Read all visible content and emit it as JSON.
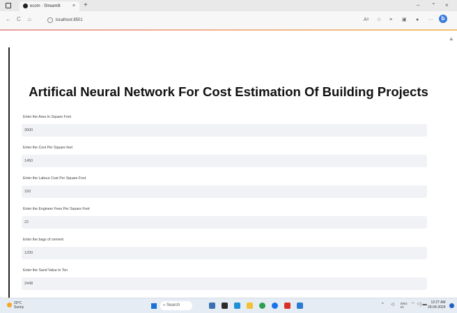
{
  "browser": {
    "tab_title": "ecom · Streamlit",
    "tab_close": "×",
    "new_tab": "+",
    "url": "localhost:8501",
    "minimize": "–",
    "restore": "⌃",
    "close": "×",
    "bing": "b"
  },
  "page": {
    "title": "Artifical Neural Network For Cost Estimation Of Building Projects",
    "fields": [
      {
        "label": "Enter the Area In Square Foot",
        "value": "3000"
      },
      {
        "label": "Enter the Cost Per Square feet",
        "value": "1450"
      },
      {
        "label": "Enter the Labour Cost Per Square Foot",
        "value": "150"
      },
      {
        "label": "Enter the Engineer Fees Per Square Foot",
        "value": "22"
      },
      {
        "label": "Enter the bags of cement",
        "value": "1200"
      },
      {
        "label": "Enter the Sand Value in Ton",
        "value": "2448"
      }
    ]
  },
  "taskbar": {
    "weather_temp": "29°C",
    "weather_desc": "Sunny",
    "search_label": "Search",
    "lang": "ENG",
    "region": "IN",
    "time": "12:27 AM",
    "date": "29-04-2024"
  },
  "colors": {
    "accent": "#1b6fd9",
    "input_bg": "#f0f2f6"
  }
}
